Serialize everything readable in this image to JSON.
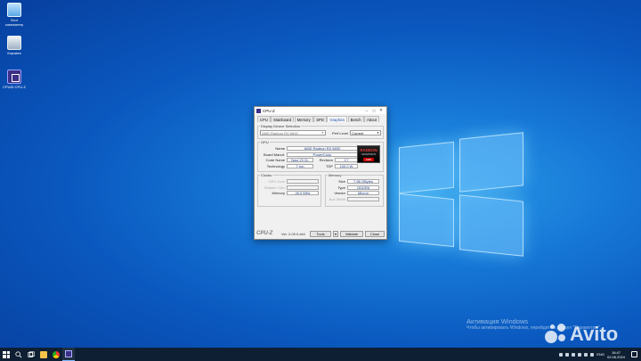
{
  "desktop": {
    "icons": [
      {
        "label": "Этот компьютер",
        "icon": "this-pc-icon"
      },
      {
        "label": "Корзина",
        "icon": "recycle-bin-icon"
      },
      {
        "label": "CPUID CPU-Z",
        "icon": "cpuz-icon"
      }
    ]
  },
  "window": {
    "title": "CPU-Z",
    "tabs": [
      "CPU",
      "Mainboard",
      "Memory",
      "SPD",
      "Graphics",
      "Bench",
      "About"
    ],
    "active_tab": "Graphics",
    "display_selection": {
      "label": "Display Device Selection",
      "device": "AMD Radeon RX 6600",
      "perf_label": "Perf Level",
      "perf_value": "Current"
    },
    "gpu": {
      "label": "GPU",
      "name_label": "Name",
      "name": "AMD Radeon RX 6600",
      "board_label": "Board Manuf.",
      "board": "PowerColor",
      "code_label": "Code Name",
      "code": "Navi 23 XL",
      "rev_label": "Revision",
      "rev": "C7",
      "tech_label": "Technology",
      "tech": "7 nm",
      "tdp_label": "TDP",
      "tdp": "100.0 W",
      "logo": {
        "line1": "RADEON",
        "line2": "GRAPHICS",
        "line3": "AMD"
      }
    },
    "clocks": {
      "label": "Clocks",
      "gpu_core_label": "GPU Core",
      "gpu_core": "",
      "shader_label": "Shader / Sec",
      "shader": "",
      "memory_label": "Memory",
      "memory": "26.0 MHz"
    },
    "memory": {
      "label": "Memory",
      "size_label": "Size",
      "size": "7.98 GBytes",
      "type_label": "Type",
      "type": "GDDR6",
      "vendor_label": "Vendor",
      "vendor": "Micron",
      "bus_label": "Bus Width",
      "bus": ""
    },
    "footer": {
      "brand": "CPU-Z",
      "version": "Ver. 2.09.0.x64",
      "tools": "Tools",
      "validate": "Validate",
      "close": "Close"
    }
  },
  "watermark": {
    "activate_title": "Активация Windows",
    "activate_sub": "Чтобы активировать Windows, перейдите в раздел \"Параметры\".",
    "avito": "Avito"
  },
  "taskbar": {
    "apps": [
      "start-icon",
      "search-icon",
      "task-view-icon",
      "file-explorer-icon",
      "chrome-icon",
      "cpuz-icon"
    ],
    "tray_lang": "ENG",
    "time": "16:47",
    "date": "02.06.2024"
  }
}
